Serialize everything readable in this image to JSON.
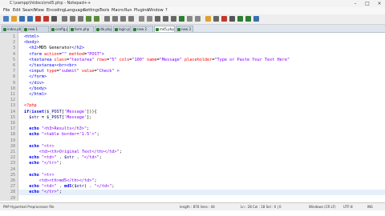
{
  "window": {
    "title": "C:\\xampp\\htdocs\\md5.php - Notepad++",
    "controls": [
      "–",
      "□",
      "×"
    ]
  },
  "menu": [
    "File",
    "Edit",
    "Search",
    "View",
    "Encoding",
    "Language",
    "Settings",
    "Tools",
    "Macro",
    "Run",
    "Plugins",
    "Window",
    "?"
  ],
  "tabs": [
    {
      "label": "index.php",
      "active": false
    },
    {
      "label": "new 1",
      "active": false
    },
    {
      "label": "config.php",
      "active": false
    },
    {
      "label": "form.php",
      "active": false
    },
    {
      "label": "db.php",
      "active": false
    },
    {
      "label": "login.php",
      "active": false
    },
    {
      "label": "new 2",
      "active": false
    },
    {
      "label": "md5.php",
      "active": true
    },
    {
      "label": "new 3",
      "active": false
    }
  ],
  "editor": {
    "lines": [
      {
        "n": "1",
        "segs": [
          {
            "t": "<html>",
            "c": "tag"
          }
        ]
      },
      {
        "n": "2",
        "segs": [
          {
            "t": "<body>",
            "c": "tag"
          }
        ]
      },
      {
        "n": "3",
        "segs": [
          {
            "t": "  <h2>",
            "c": "tag"
          },
          {
            "t": "MD5 Generator",
            "c": ""
          },
          {
            "t": "</h2>",
            "c": "tag"
          }
        ]
      },
      {
        "n": "4",
        "segs": [
          {
            "t": "  <form ",
            "c": "tag"
          },
          {
            "t": "action",
            "c": "attr"
          },
          {
            "t": "=",
            "c": ""
          },
          {
            "t": "\"\"",
            "c": "str"
          },
          {
            "t": " method",
            "c": "attr"
          },
          {
            "t": "=",
            "c": ""
          },
          {
            "t": "\"POST\"",
            "c": "str"
          },
          {
            "t": ">",
            "c": "tag"
          }
        ]
      },
      {
        "n": "5",
        "segs": [
          {
            "t": "  <textarea ",
            "c": "tag"
          },
          {
            "t": "class",
            "c": "attr"
          },
          {
            "t": "=",
            "c": ""
          },
          {
            "t": "\"textarea\"",
            "c": "str"
          },
          {
            "t": " rows",
            "c": "attr"
          },
          {
            "t": "=",
            "c": ""
          },
          {
            "t": "\"5\"",
            "c": "str"
          },
          {
            "t": " cols",
            "c": "attr"
          },
          {
            "t": "=",
            "c": ""
          },
          {
            "t": "\"100\"",
            "c": "str"
          },
          {
            "t": " name",
            "c": "attr"
          },
          {
            "t": "=",
            "c": ""
          },
          {
            "t": "\"Message\"",
            "c": "str"
          },
          {
            "t": " placeholder",
            "c": "attr"
          },
          {
            "t": "=",
            "c": ""
          },
          {
            "t": "\"Type or Paste Your Text Here\"",
            "c": "str"
          }
        ]
      },
      {
        "n": "6",
        "segs": [
          {
            "t": "  </textarea>",
            "c": "tag"
          },
          {
            "t": "<br>",
            "c": "tag"
          },
          {
            "t": "<br>",
            "c": "tag"
          }
        ]
      },
      {
        "n": "7",
        "segs": [
          {
            "t": "  <input ",
            "c": "tag"
          },
          {
            "t": "type",
            "c": "attr"
          },
          {
            "t": "=",
            "c": ""
          },
          {
            "t": "\"submit\"",
            "c": "str"
          },
          {
            "t": " value",
            "c": "attr"
          },
          {
            "t": "=",
            "c": ""
          },
          {
            "t": "\"Check\"",
            "c": "str"
          },
          {
            "t": " >",
            "c": "tag"
          }
        ]
      },
      {
        "n": "8",
        "segs": [
          {
            "t": "  </form>",
            "c": "tag"
          }
        ]
      },
      {
        "n": "9",
        "segs": [
          {
            "t": "  </div>",
            "c": "tag"
          }
        ]
      },
      {
        "n": "10",
        "segs": [
          {
            "t": "  </body>",
            "c": "tag"
          }
        ]
      },
      {
        "n": "11",
        "segs": [
          {
            "t": "  </html>",
            "c": "tag"
          }
        ]
      },
      {
        "n": "12",
        "segs": [
          {
            "t": "",
            "c": ""
          }
        ]
      },
      {
        "n": "13",
        "segs": [
          {
            "t": "<?php",
            "c": "php"
          }
        ]
      },
      {
        "n": "14",
        "segs": [
          {
            "t": "if",
            "c": "kw"
          },
          {
            "t": "(",
            "c": ""
          },
          {
            "t": "isset",
            "c": "kw"
          },
          {
            "t": "(",
            "c": ""
          },
          {
            "t": "$_POST",
            "c": "var"
          },
          {
            "t": "[",
            "c": ""
          },
          {
            "t": "'Message'",
            "c": "str"
          },
          {
            "t": "])){",
            "c": ""
          }
        ]
      },
      {
        "n": "15",
        "segs": [
          {
            "t": "  $str",
            "c": "var"
          },
          {
            "t": " = ",
            "c": ""
          },
          {
            "t": "$_POST",
            "c": "var"
          },
          {
            "t": "[",
            "c": ""
          },
          {
            "t": "'Message'",
            "c": "str"
          },
          {
            "t": "];",
            "c": ""
          }
        ]
      },
      {
        "n": "16",
        "segs": [
          {
            "t": "",
            "c": ""
          }
        ]
      },
      {
        "n": "17",
        "segs": [
          {
            "t": "  echo ",
            "c": "kw"
          },
          {
            "t": "\"<h3>Results</h3>\"",
            "c": "str"
          },
          {
            "t": ";",
            "c": ""
          }
        ]
      },
      {
        "n": "18",
        "segs": [
          {
            "t": "  echo ",
            "c": "kw"
          },
          {
            "t": "\"<table border='1.5'>\"",
            "c": "str"
          },
          {
            "t": ";",
            "c": ""
          }
        ]
      },
      {
        "n": "19",
        "segs": [
          {
            "t": "",
            "c": ""
          }
        ]
      },
      {
        "n": "20",
        "segs": [
          {
            "t": "  echo ",
            "c": "kw"
          },
          {
            "t": "\"<tr>",
            "c": "str"
          }
        ]
      },
      {
        "n": "21",
        "segs": [
          {
            "t": "      <td><th>Original Text</th></td>\"",
            "c": "str"
          },
          {
            "t": ";",
            "c": ""
          }
        ]
      },
      {
        "n": "22",
        "segs": [
          {
            "t": "  echo ",
            "c": "kw"
          },
          {
            "t": "\"<td>\"",
            "c": "str"
          },
          {
            "t": " . ",
            "c": ""
          },
          {
            "t": "$str",
            "c": "var"
          },
          {
            "t": " . ",
            "c": ""
          },
          {
            "t": "\"</td>\"",
            "c": "str"
          },
          {
            "t": ";",
            "c": ""
          }
        ]
      },
      {
        "n": "23",
        "segs": [
          {
            "t": "  echo ",
            "c": "kw"
          },
          {
            "t": "\"</tr>\"",
            "c": "str"
          },
          {
            "t": ";",
            "c": ""
          }
        ]
      },
      {
        "n": "24",
        "segs": [
          {
            "t": "",
            "c": ""
          }
        ]
      },
      {
        "n": "25",
        "segs": [
          {
            "t": "  echo ",
            "c": "kw"
          },
          {
            "t": "\"<tr>",
            "c": "str"
          }
        ]
      },
      {
        "n": "26",
        "segs": [
          {
            "t": "      <td><th>md5</th></td>\"",
            "c": "str"
          },
          {
            "t": ";",
            "c": ""
          }
        ]
      },
      {
        "n": "27",
        "segs": [
          {
            "t": "  echo ",
            "c": "kw"
          },
          {
            "t": "\"<td>\"",
            "c": "str"
          },
          {
            "t": " . ",
            "c": ""
          },
          {
            "t": "md5",
            "c": "kw"
          },
          {
            "t": "(",
            "c": ""
          },
          {
            "t": "$str",
            "c": "var"
          },
          {
            "t": ") . ",
            "c": ""
          },
          {
            "t": "\"</td>\"",
            "c": "str"
          },
          {
            "t": ";",
            "c": ""
          }
        ]
      },
      {
        "n": "28",
        "segs": [
          {
            "t": "  echo ",
            "c": "kw"
          },
          {
            "t": "\"</tr>\"",
            "c": "str"
          },
          {
            "t": ";",
            "c": ""
          }
        ]
      },
      {
        "n": "29",
        "segs": [
          {
            "t": "",
            "c": ""
          }
        ]
      }
    ],
    "current_line": "28"
  },
  "status": {
    "language": "PHP Hypertext Preprocessor file",
    "length": "length : 876    lines : 44",
    "position": "Ln : 28    Col : 18    Sel : 0 | 0",
    "eol": "Windows (CR LF)",
    "encoding": "UTF-8",
    "mode": "INS"
  },
  "colors": {
    "tag": "#0000ff",
    "attr": "#ff0000",
    "string": "#8000ff",
    "keyword": "#0000ff",
    "variable": "#000080"
  }
}
